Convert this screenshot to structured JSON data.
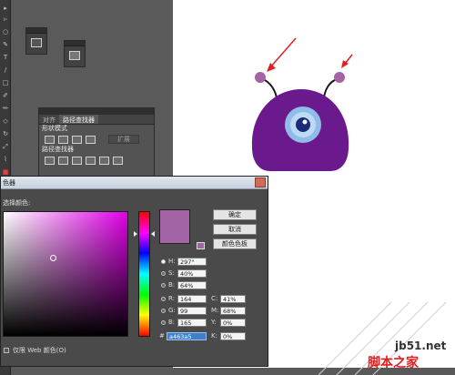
{
  "panels": {
    "pathfinder": {
      "tabs": [
        "对齐",
        "路径查找器"
      ],
      "shape_modes_label": "形状模式",
      "expand_label": "扩展",
      "pathfinders_label": "路径查找器"
    }
  },
  "dialog": {
    "title": "色器",
    "select_color_label": "选择颜色:",
    "buttons": {
      "ok": "确定",
      "cancel": "取消",
      "swatches": "颜色色板"
    },
    "fields": {
      "H": {
        "label": "H:",
        "value": "297°"
      },
      "S": {
        "label": "S:",
        "value": "40%"
      },
      "B": {
        "label": "B:",
        "value": "64%"
      },
      "R": {
        "label": "R:",
        "value": "164"
      },
      "G": {
        "label": "G:",
        "value": "99"
      },
      "Bl": {
        "label": "B:",
        "value": "165"
      },
      "C": {
        "label": "C:",
        "value": "41%"
      },
      "M": {
        "label": "M:",
        "value": "68%"
      },
      "Y": {
        "label": "Y:",
        "value": "0%"
      },
      "K": {
        "label": "K:",
        "value": "0%"
      },
      "hex": {
        "label": "#",
        "value": "a463a5"
      }
    },
    "web_only_label": "仅限 Web 颜色(O)",
    "selected_color": "#a463a5"
  },
  "artwork": {
    "body_color": "#6a1a8c",
    "eye_ring_color": "#8fbde8",
    "pupil_color": "#1a2b7a",
    "antenna_ball_color": "#a463a5",
    "arrow_color": "#e02020"
  },
  "watermark": {
    "url": "jb51.net",
    "site": "脚本之家"
  }
}
